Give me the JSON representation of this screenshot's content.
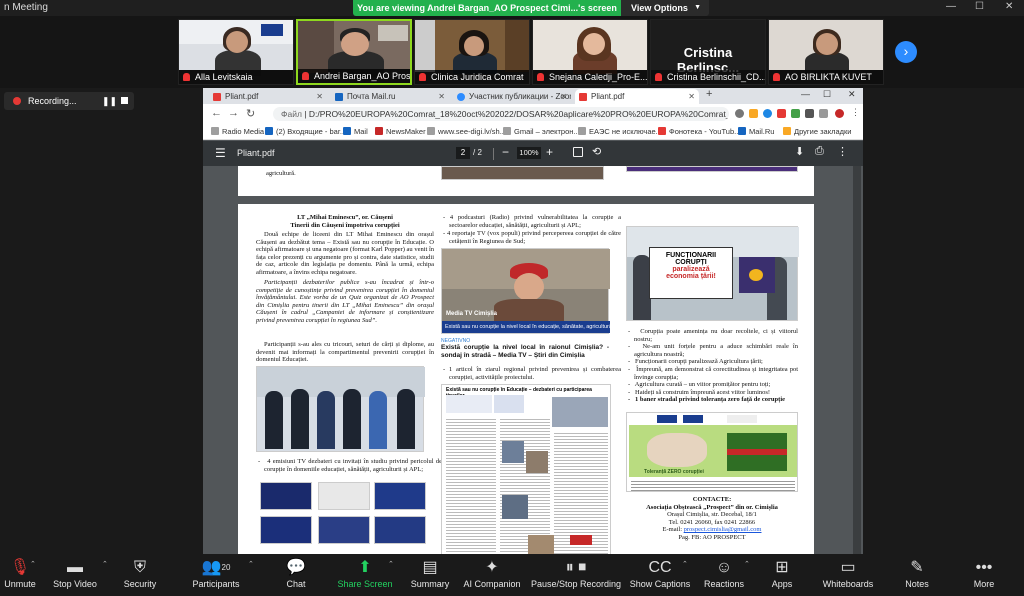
{
  "zoom": {
    "app_title": "n Meeting",
    "viewing_banner": "You are viewing Andrei Bargan_AO Prospect Cimi...'s screen",
    "view_options": "View Options",
    "participants_thumbs": [
      {
        "name": "Alla Levitskaia"
      },
      {
        "name": "Andrei Bargan_AO Prospe..."
      },
      {
        "name": "Clinica Juridica Comrat"
      },
      {
        "name": "Snejana Caledji_Pro-E..."
      },
      {
        "name": "Cristina Berlinschii_CD...",
        "video_text": "Cristina  Berlinsc..."
      },
      {
        "name": "AO BIRLIKTA KUVET"
      }
    ],
    "recording_label": "Recording...",
    "toolbar": [
      {
        "label": "Unmute",
        "icon": "mic-muted-icon"
      },
      {
        "label": "Stop Video",
        "icon": "video-icon"
      },
      {
        "label": "Security",
        "icon": "shield-icon"
      },
      {
        "label": "Participants",
        "icon": "participants-icon",
        "count": "20"
      },
      {
        "label": "Chat",
        "icon": "chat-icon"
      },
      {
        "label": "Share Screen",
        "icon": "share-screen-icon"
      },
      {
        "label": "Summary",
        "icon": "summary-icon"
      },
      {
        "label": "AI Companion",
        "icon": "ai-companion-icon"
      },
      {
        "label": "Pause/Stop Recording",
        "icon": "pause-record-icon"
      },
      {
        "label": "Show Captions",
        "icon": "captions-icon"
      },
      {
        "label": "Reactions",
        "icon": "reactions-icon"
      },
      {
        "label": "Apps",
        "icon": "apps-icon"
      },
      {
        "label": "Whiteboards",
        "icon": "whiteboard-icon"
      },
      {
        "label": "Notes",
        "icon": "notes-icon"
      },
      {
        "label": "More",
        "icon": "more-icon"
      }
    ]
  },
  "browser": {
    "tabs": [
      {
        "title": "Pliant.pdf",
        "color": "#e53935"
      },
      {
        "title": "Почта Mail.ru",
        "color": "#1565c0"
      },
      {
        "title": "Участник публикации - Zoom",
        "color": "#2d8cff"
      },
      {
        "title": "Pliant.pdf",
        "color": "#e53935"
      }
    ],
    "url_label": "Файл",
    "url": "D:/PRO%20EUROPA%20Comrat_18%20oct%202022/DOSAR%20aplicare%20PRO%20EUROPA%20Comrat_AO%20PROSP...",
    "bookmarks": [
      {
        "label": "Radio Media",
        "color": "#9e9e9e"
      },
      {
        "label": "(2) Входящие - bar...",
        "color": "#1565c0"
      },
      {
        "label": "Mail",
        "color": "#1565c0"
      },
      {
        "label": "NewsMaker",
        "color": "#c62828"
      },
      {
        "label": "www.see-digi.lv/sh...",
        "color": "#9e9e9e"
      },
      {
        "label": "Gmail – электрон...",
        "color": "#9e9e9e"
      },
      {
        "label": "EAЭС не исключае...",
        "color": "#9e9e9e"
      },
      {
        "label": "Фонотека - YouTub...",
        "color": "#e53935"
      },
      {
        "label": "Mail.Ru",
        "color": "#1565c0"
      },
      {
        "label": "Другие закладки",
        "color": "#f9a825"
      }
    ],
    "pdf": {
      "filename": "Pliant.pdf",
      "page": "2",
      "page_total": "/  2",
      "zoom": "100%"
    }
  },
  "document": {
    "top_snippet": "agricultură.",
    "col1_heading": "LT „Mihai Eminescu”, or. Căușeni",
    "col1_subheading": "Tinerii din Căușeni împotriva corupției",
    "col1_p1": "Două echipe de liceeni din LT Mihai Eminescu din orașul Căușeni au dezbătut tema – Există sau nu corupție în Educație. O echipă afirmatoare și una negatoare (format Karl Popper) au venit în fața celor prezenți cu argumente pro și contra, date statistice, studii de caz, articole din legislația pe domeniu. Până la urmă, echipa afirmatoare, a învins echipa negatoare.",
    "col1_p2": "Participanții dezbaterilor publice s-au încadrat și într-o competiție de cunoștințe privind prevenirea corupției în domeniul învățământului. Este vorba de un Quiz organizat de AO Prospect din Cimișlia pentru tinerii din LT „Mihai Eminescu” din orașul Căușeni în cadrul „Campaniei de informare și conștientizare privind prevenirea corupției în regiunea Sud”.",
    "col1_p3": "Participanții s-au ales cu tricouri, seturi de cărți și diplome, au devenit mai informați la compartimentul prevenirii corupției în domeniul Educației.",
    "col1_bullet": "4 emisiuni TV dezbateri cu invitați în studiu privind pericolul de corupție în domeniile educației, sănătății, agriculturii și APL;",
    "col2_b1": "4 podcasturi (Radio) privind vulnerabilitatea la corupție a sectoarelor educației, sănătății, agriculturii și APL;",
    "col2_b2": "4 reportaje TV (vox populi) privind percepereea corupției de către cetățenii în Regiunea de Sud;",
    "video_tag": "Media TV Cimișlia",
    "video_caption": "Există sau nu corupție la nivel local în educație, sănătate, agricultură",
    "video_kicker": "NEGATIVNO",
    "video_title": "Există corupție la nivel local în raionul Cimișlia? -sondaj în stradă – Media TV – Știri din Cimișlia",
    "col2_b3": "1 articol în ziarul regional privind prevenirea și combaterea corupției, activitățile proiectului.",
    "article_title": "Există sau nu corupție în Educație – dezbateri cu participarea tinerilor",
    "poster_line1": "FUNCȚIONARII",
    "poster_line2": "CORUPȚI",
    "poster_line3": "paralizează",
    "poster_line4": "economia țării!",
    "col3_bullets": [
      "Corupția poate amenința nu doar recoltele, ci și viitorul nostru;",
      "Ne-am unit forțele pentru a aduce schimbări reale în agricultura noastră;",
      "Funcționarii corupți paralizează Agricultura țării;",
      "Împreună, am demonstrat că corectitudinea și integritatea pot învinge corupția;",
      "Agricultura curată – un viitor promițător pentru toți;",
      "Haideți să construim împreună acest viitor luminos!"
    ],
    "col3_banner_line": "1 baner stradal privind toleranța zero față de corupție",
    "banner_text": "Toleranță ZERO corupției",
    "contact_title": "CONTACTE:",
    "contact_org": "Asociația Obștească „Prospect” din or. Cimișlia",
    "contact_addr": "Orașul Cimișlia, str. Decebal, 18/1",
    "contact_tel": "Tel. 0241 26060, fax 0241 22866",
    "contact_email_label": "E-mail:",
    "contact_email": "prospect.cimislia@gmail.com",
    "contact_fb": "Pag. FB: AO PROSPECT"
  }
}
